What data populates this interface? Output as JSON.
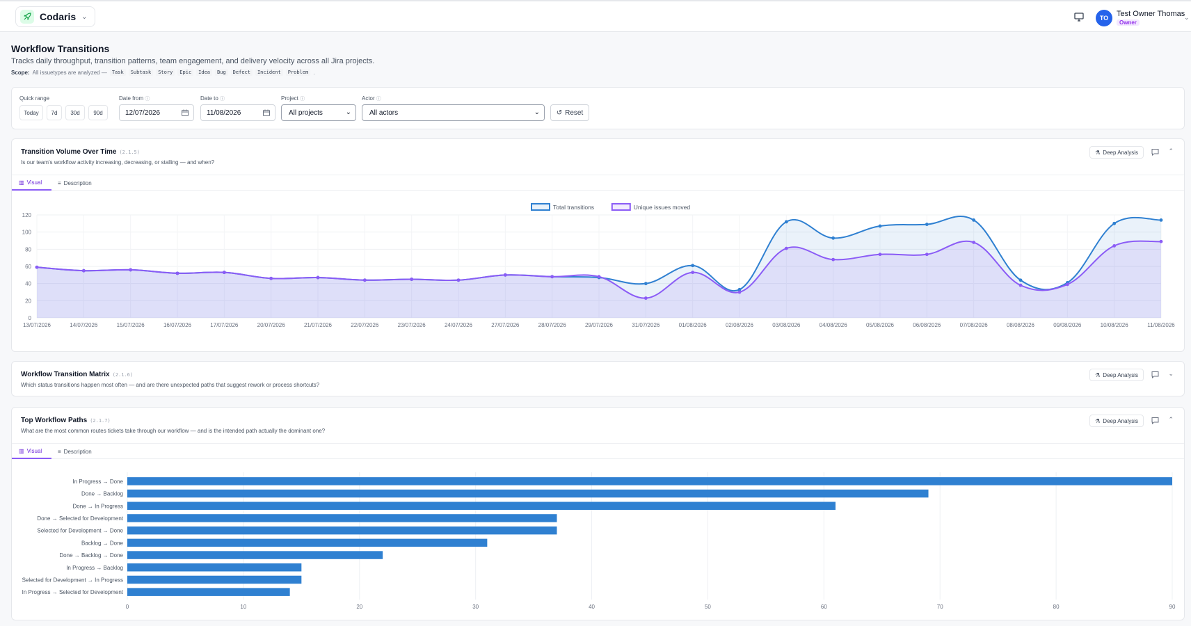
{
  "app": {
    "name": "Codaris",
    "user": {
      "initials": "TO",
      "name": "Test Owner Thomas",
      "role": "Owner"
    }
  },
  "page": {
    "title": "Workflow Transitions",
    "subtitle": "Tracks daily throughput, transition patterns, team engagement, and delivery velocity across all Jira projects.",
    "scope_label": "Scope:",
    "scope_text": "All issuetypes are analyzed —",
    "scope_end": ".",
    "issue_types": [
      "Task",
      "Subtask",
      "Story",
      "Epic",
      "Idea",
      "Bug",
      "Defect",
      "Incident",
      "Problem"
    ]
  },
  "filters": {
    "quick_range_label": "Quick range",
    "quick_ranges": [
      "Today",
      "7d",
      "30d",
      "90d"
    ],
    "date_from_label": "Date from",
    "date_from": "12/07/2026",
    "date_to_label": "Date to",
    "date_to": "11/08/2026",
    "project_label": "Project",
    "project_value": "All projects",
    "actor_label": "Actor",
    "actor_value": "All actors",
    "reset_label": "Reset"
  },
  "cards": {
    "volume": {
      "title": "Transition Volume Over Time",
      "code": "(2.1.5)",
      "question": "Is our team's workflow activity increasing, decreasing, or stalling — and when?",
      "deep_label": "Deep Analysis",
      "tab_visual": "Visual",
      "tab_description": "Description"
    },
    "matrix": {
      "title": "Workflow Transition Matrix",
      "code": "(2.1.6)",
      "question": "Which status transitions happen most often — and are there unexpected paths that suggest rework or process shortcuts?",
      "deep_label": "Deep Analysis"
    },
    "paths": {
      "title": "Top Workflow Paths",
      "code": "(2.1.7)",
      "question": "What are the most common routes tickets take through our workflow — and is the intended path actually the dominant one?",
      "deep_label": "Deep Analysis",
      "tab_visual": "Visual",
      "tab_description": "Description"
    }
  },
  "colors": {
    "total": "#2f80d1",
    "unique": "#8b5cf6",
    "bar": "#2f80d1"
  },
  "chart_data": [
    {
      "type": "line",
      "x": [
        "13/07/2026",
        "14/07/2026",
        "15/07/2026",
        "16/07/2026",
        "17/07/2026",
        "20/07/2026",
        "21/07/2026",
        "22/07/2026",
        "23/07/2026",
        "24/07/2026",
        "27/07/2026",
        "28/07/2026",
        "29/07/2026",
        "31/07/2026",
        "01/08/2026",
        "02/08/2026",
        "03/08/2026",
        "04/08/2026",
        "05/08/2026",
        "06/08/2026",
        "07/08/2026",
        "08/08/2026",
        "09/08/2026",
        "10/08/2026",
        "11/08/2026"
      ],
      "series": [
        {
          "name": "Total transitions",
          "values": [
            59,
            55,
            56,
            52,
            53,
            46,
            47,
            44,
            45,
            44,
            50,
            48,
            47,
            40,
            61,
            33,
            112,
            93,
            107,
            109,
            114,
            44,
            41,
            110,
            114
          ]
        },
        {
          "name": "Unique issues moved",
          "values": [
            59,
            55,
            56,
            52,
            53,
            46,
            47,
            44,
            45,
            44,
            50,
            48,
            48,
            23,
            53,
            30,
            81,
            68,
            74,
            74,
            88,
            38,
            39,
            84,
            89
          ]
        }
      ],
      "ylim": [
        0,
        120
      ],
      "yticks": [
        0,
        20,
        40,
        60,
        80,
        100,
        120
      ],
      "legend": "top-center",
      "grid": true
    },
    {
      "type": "bar",
      "orientation": "horizontal",
      "categories": [
        "In Progress → Done",
        "Done → Backlog",
        "Done → In Progress",
        "Done → Selected for Development",
        "Selected for Development → Done",
        "Backlog → Done",
        "Done → Backlog → Done",
        "In Progress → Backlog",
        "Selected for Development → In Progress",
        "In Progress → Selected for Development"
      ],
      "values": [
        90,
        69,
        61,
        37,
        37,
        31,
        22,
        15,
        15,
        14
      ],
      "xlim": [
        0,
        90
      ],
      "xticks": [
        0,
        10,
        20,
        30,
        40,
        50,
        60,
        70,
        80,
        90
      ],
      "grid": true
    }
  ]
}
